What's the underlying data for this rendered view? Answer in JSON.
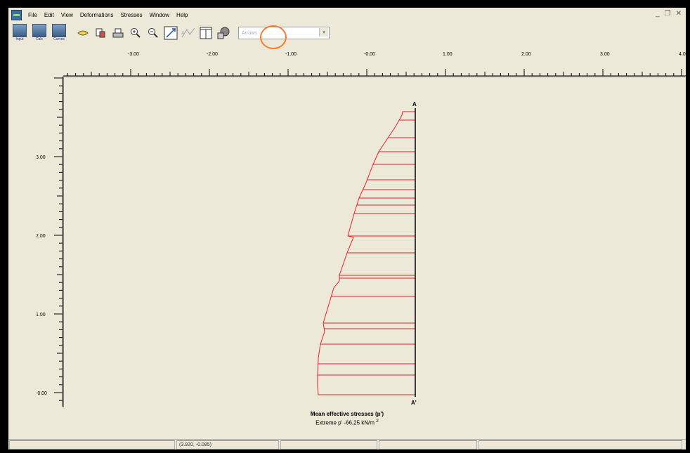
{
  "menu": {
    "items": [
      "File",
      "Edit",
      "View",
      "Deformations",
      "Stresses",
      "Window",
      "Help"
    ],
    "window_controls": [
      "_",
      "❐",
      "✕"
    ]
  },
  "toolbar": {
    "program_buttons": [
      {
        "label": "Input",
        "icon": "input-program-icon"
      },
      {
        "label": "Calc",
        "icon": "calc-program-icon"
      },
      {
        "label": "Curves",
        "icon": "curves-program-icon"
      }
    ],
    "tools": [
      {
        "name": "open-icon"
      },
      {
        "name": "copy-icon"
      },
      {
        "name": "print-icon"
      },
      {
        "name": "zoom-in-icon"
      },
      {
        "name": "zoom-out-icon"
      },
      {
        "name": "reset-view-icon"
      },
      {
        "name": "cross-section-icon"
      },
      {
        "name": "table-icon"
      },
      {
        "name": "structures-icon"
      }
    ],
    "highlight_color": "#ff7a2a",
    "combo_value": "Arrows"
  },
  "rulers": {
    "horizontal_labels": [
      "-3.00",
      "-2.00",
      "-1.00",
      "-0.00",
      "1.00",
      "2.00",
      "3.00",
      "4.0"
    ],
    "vertical_labels": [
      "3.00",
      "2.00",
      "1.00",
      "-0.00"
    ]
  },
  "plot": {
    "top_label": "A",
    "bottom_label": "A'",
    "stress_color": "#e8202a",
    "wall_color": "#000000"
  },
  "caption": {
    "title": "Mean effective stresses (p')",
    "extreme_prefix": "Extreme p' -66,25  kN/m",
    "extreme_exponent": "2"
  },
  "status": {
    "coords": "(3.920, -0.085)"
  }
}
